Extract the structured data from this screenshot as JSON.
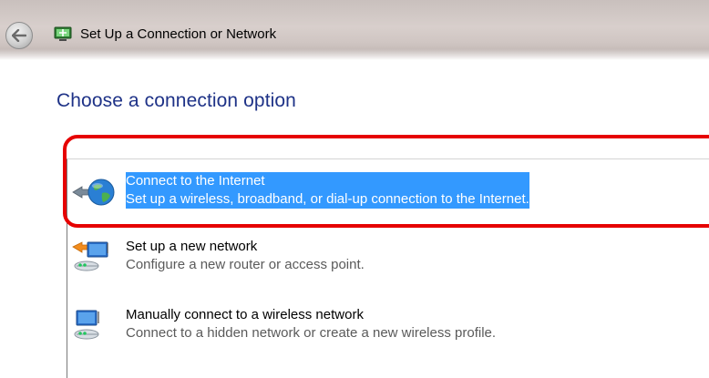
{
  "window": {
    "title": "Set Up a Connection or Network"
  },
  "page": {
    "heading": "Choose a connection option"
  },
  "options": [
    {
      "title": "Connect to the Internet",
      "description": "Set up a wireless, broadband, or dial-up connection to the Internet.",
      "icon": "globe-network-icon",
      "selected": true
    },
    {
      "title": "Set up a new network",
      "description": "Configure a new router or access point.",
      "icon": "router-setup-icon",
      "selected": false
    },
    {
      "title": "Manually connect to a wireless network",
      "description": "Connect to a hidden network or create a new wireless profile.",
      "icon": "wireless-network-icon",
      "selected": false
    }
  ],
  "colors": {
    "heading": "#1e3287",
    "selection": "#3399ff",
    "annotation_ring": "#e60000"
  }
}
